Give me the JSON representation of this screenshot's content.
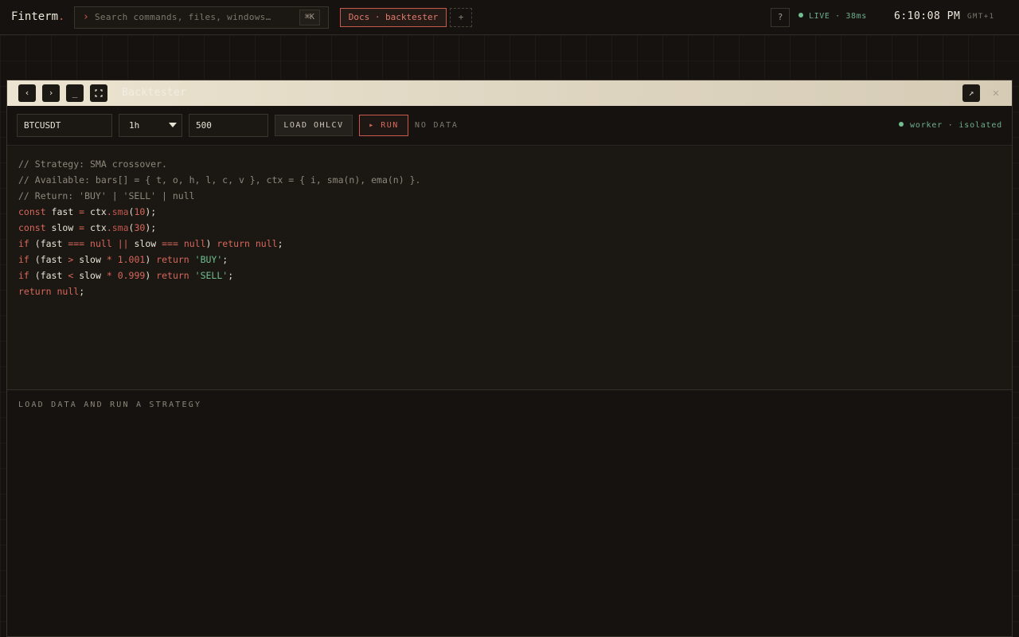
{
  "topbar": {
    "logo_text": "Finterm",
    "logo_dot": ".",
    "search_placeholder": "Search commands, files, windows…",
    "search_shortcut": "⌘K",
    "active_tab": "Docs · backtester",
    "add_tab": "+",
    "help": "?",
    "live_status": "LIVE · 38ms",
    "clock": "6:10:08 PM",
    "timezone": "GMT+1"
  },
  "window": {
    "title": "Backtester",
    "controls": {
      "back": "‹",
      "forward": "›",
      "minimize": "_",
      "expand": "⛶",
      "popout": "↗",
      "close": "✕"
    }
  },
  "toolbar": {
    "symbol": "BTCUSDT",
    "interval": "1h",
    "bars": "500",
    "load_label": "LOAD OHLCV",
    "run_label": "▸ RUN",
    "data_status": "NO DATA",
    "worker_status": "worker · isolated"
  },
  "editor": {
    "lines": [
      "// Strategy: SMA crossover.",
      "// Available: bars[] = { t, o, h, l, c, v }, ctx = { i, sma(n), ema(n) }.",
      "// Return: 'BUY' | 'SELL' | null",
      "const fast = ctx.sma(10);",
      "const slow = ctx.sma(30);",
      "if (fast === null || slow === null) return null;",
      "if (fast > slow * 1.001) return 'BUY';",
      "if (fast < slow * 0.999) return 'SELL';",
      "return null;"
    ]
  },
  "results": {
    "empty_message": "LOAD DATA AND RUN A STRATEGY"
  },
  "colors": {
    "accent": "#c9594d",
    "live": "#6fbf90",
    "background": "#15120f"
  }
}
